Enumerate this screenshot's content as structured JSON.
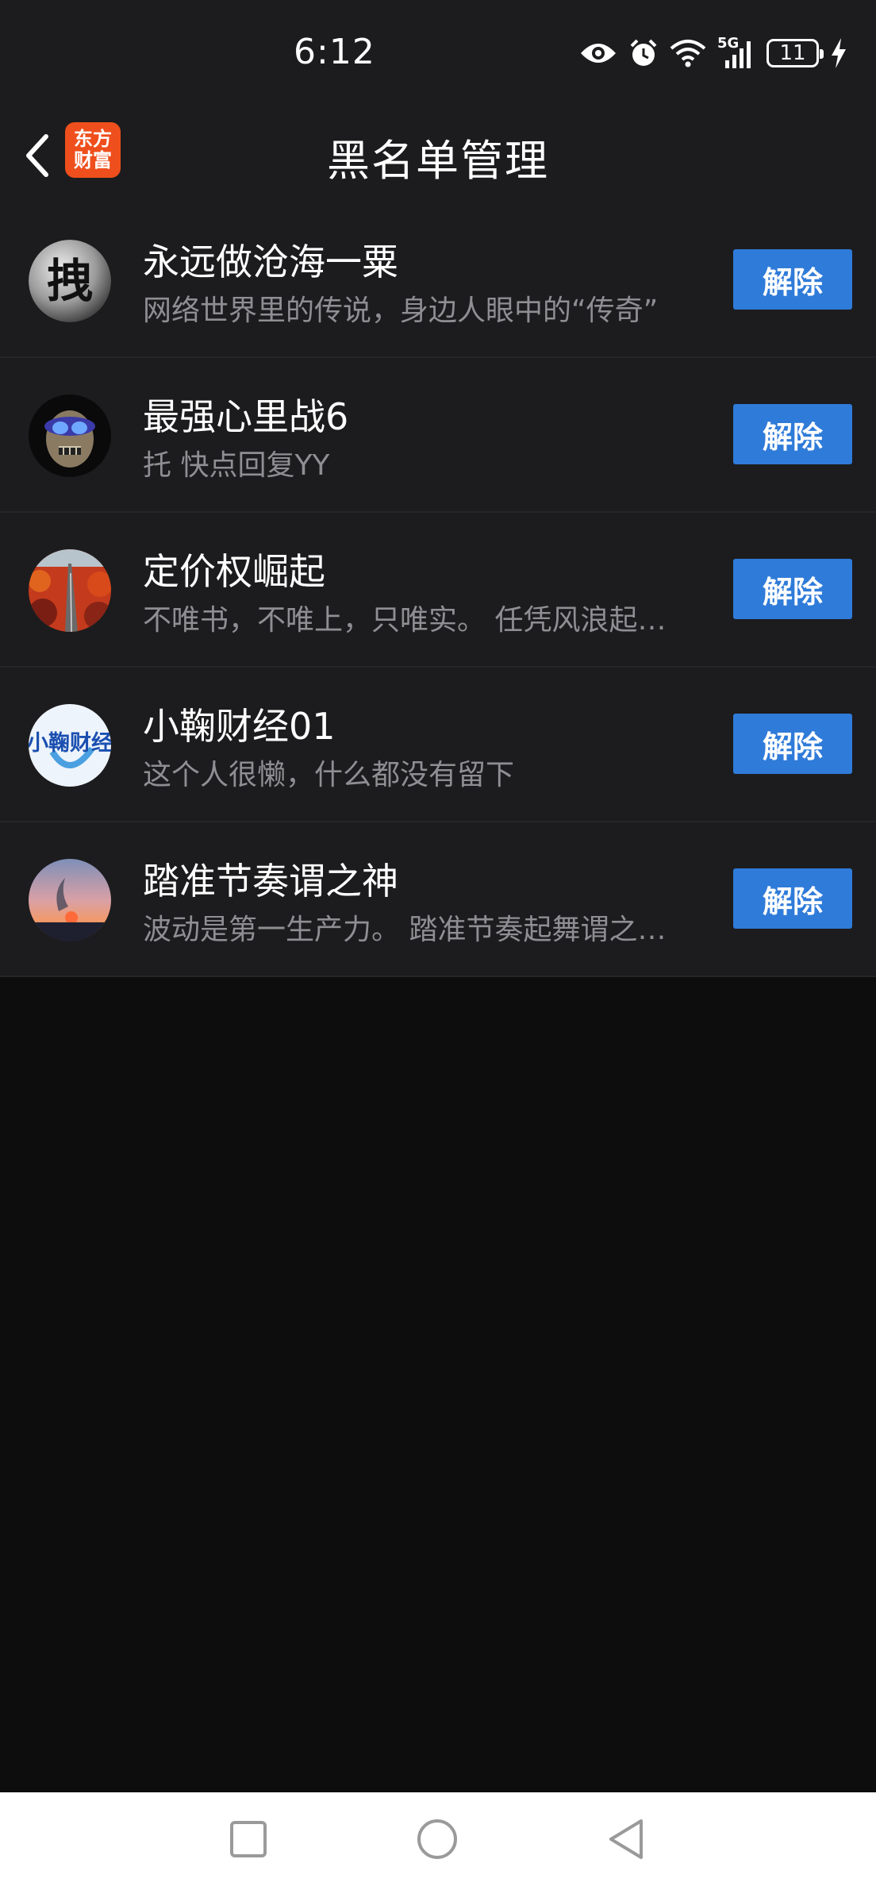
{
  "status_bar": {
    "time": "6:12",
    "network": "5G",
    "battery": "11",
    "icons": [
      "eye-icon",
      "alarm-icon",
      "wifi-icon",
      "signal-icon",
      "battery-icon",
      "charging-icon"
    ]
  },
  "header": {
    "title": "黑名单管理",
    "logo_line1": "东方",
    "logo_line2": "财富",
    "back_icon": "chevron-left-icon"
  },
  "colors": {
    "accent": "#2f7bd9",
    "logo": "#ef4f1c",
    "list_bg": "#1c1c1e",
    "page_bg": "#0d0d0d"
  },
  "users": [
    {
      "name": "永远做沧海一粟",
      "signature": "网络世界里的传说，身边人眼中的“传奇”",
      "button": "解除"
    },
    {
      "name": "最强心里战6",
      "signature": "托 快点回复YY",
      "button": "解除"
    },
    {
      "name": "定价权崛起",
      "signature": "不唯书，不唯上，只唯实。 任凭风浪起…",
      "button": "解除"
    },
    {
      "name": "小鞠财经01",
      "signature": "这个人很懒，什么都没有留下",
      "button": "解除"
    },
    {
      "name": "踏准节奏谓之神",
      "signature": "波动是第一生产力。 踏准节奏起舞谓之…",
      "button": "解除"
    }
  ],
  "avatars": {
    "avatar1_char": "拽",
    "avatar4_text": "小鞠财经"
  },
  "system_nav": [
    "square-icon",
    "circle-icon",
    "triangle-back-icon"
  ]
}
